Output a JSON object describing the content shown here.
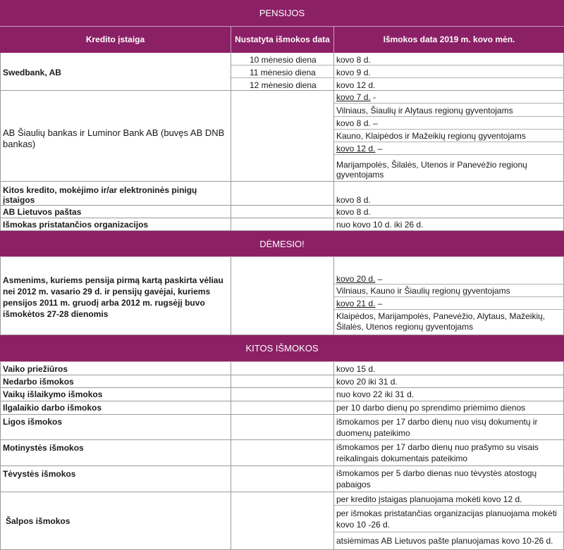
{
  "sections": {
    "pensions": "PENSIJOS",
    "attention": "DĖMESIO!",
    "other": "KITOS IŠMOKOS"
  },
  "headers": {
    "institution": "Kredito įstaiga",
    "set_date": "Nustatyta išmokos data",
    "payment_date": "Išmokos data 2019 m. kovo mėn."
  },
  "swedbank": {
    "name": "Swedbank, AB",
    "set_dates": [
      "10 mėnesio diena",
      "11 mėnesio diena",
      "12 mėnesio diena"
    ],
    "pay_dates": [
      "kovo 8  d.",
      "kovo 9 d.",
      "kovo 12 d."
    ]
  },
  "siauliu": {
    "name": "AB Šiaulių bankas ir  Luminor Bank AB (buvęs AB DNB bankas)",
    "date1": "kovo 7 d.",
    "sep1": " -",
    "region1": "Vilniaus, Šiaulių ir Alytaus regionų gyventojams",
    "date2": "kovo 8 d. –",
    "region2": "Kauno, Klaipėdos ir Mažeikių regionų gyventojams",
    "date3": "kovo 12 d.",
    "sep3": " –",
    "region3": "Marijampolės, Šilalės, Utenos ir Panevėžio regionų gyventojams"
  },
  "kitos_kredito": {
    "name": "Kitos kredito, mokėjimo ir/ar elektroninės pinigų įstaigos",
    "pay": "kovo 8 d."
  },
  "pastas": {
    "name": "AB Lietuvos paštas",
    "pay": "kovo 8 d."
  },
  "pristatancios": {
    "name": "Išmokas pristatančios  organizacijos",
    "pay": "nuo kovo 10 d. iki 26 d."
  },
  "attention_row": {
    "text": "Asmenims, kuriems pensija pirmą kartą paskirta vėliau nei 2012 m. vasario 29 d. ir pensijų gavėjai, kuriems pensijos 2011 m. gruodį arba 2012 m. rugsėjį buvo išmokėtos 27-28 dienomis",
    "date1": "kovo 20 d.",
    "sep1": " –",
    "region1": "Vilniaus, Kauno ir Šiaulių regionų gyventojams",
    "date2": "kovo 21 d.",
    "sep2": " –",
    "region2": "Klaipėdos, Marijampolės, Panevėžio, Alytaus, Mažeikių, Šilalės, Utenos regionų gyventojams"
  },
  "other_rows": [
    {
      "name": "Vaiko  priežiūros",
      "pay": "kovo 15 d."
    },
    {
      "name": "Nedarbo išmokos",
      "pay": "kovo 20 iki 31 d."
    },
    {
      "name": "Vaikų išlaikymo išmokos",
      "pay": "nuo kovo 22 iki 31 d."
    },
    {
      "name": "Ilgalaikio darbo išmokos",
      "pay": "per 10 darbo dienų po sprendimo priėmimo dienos"
    },
    {
      "name": "Ligos išmokos",
      "pay": "išmokamos per 17 darbo dienų nuo visų dokumentų ir duomenų pateikimo"
    },
    {
      "name": "Motinystės išmokos",
      "pay": "išmokamos per 17 darbo dienų nuo prašymo su visais reikalingais dokumentais pateikimo"
    },
    {
      "name": "Tėvystės išmokos",
      "pay": "išmokamos per 5 darbo dienas nuo tėvystės atostogų pabaigos"
    }
  ],
  "salpos": {
    "name": "Šalpos išmokos",
    "pay": [
      "per kredito įstaigas planuojama mokėti kovo  12 d.",
      "per išmokas pristatančias organizacijas planuojama mokėti kovo 10 -26 d.",
      "atsiėmimas AB Lietuvos pašte planuojamas  kovo 10-26 d."
    ]
  }
}
